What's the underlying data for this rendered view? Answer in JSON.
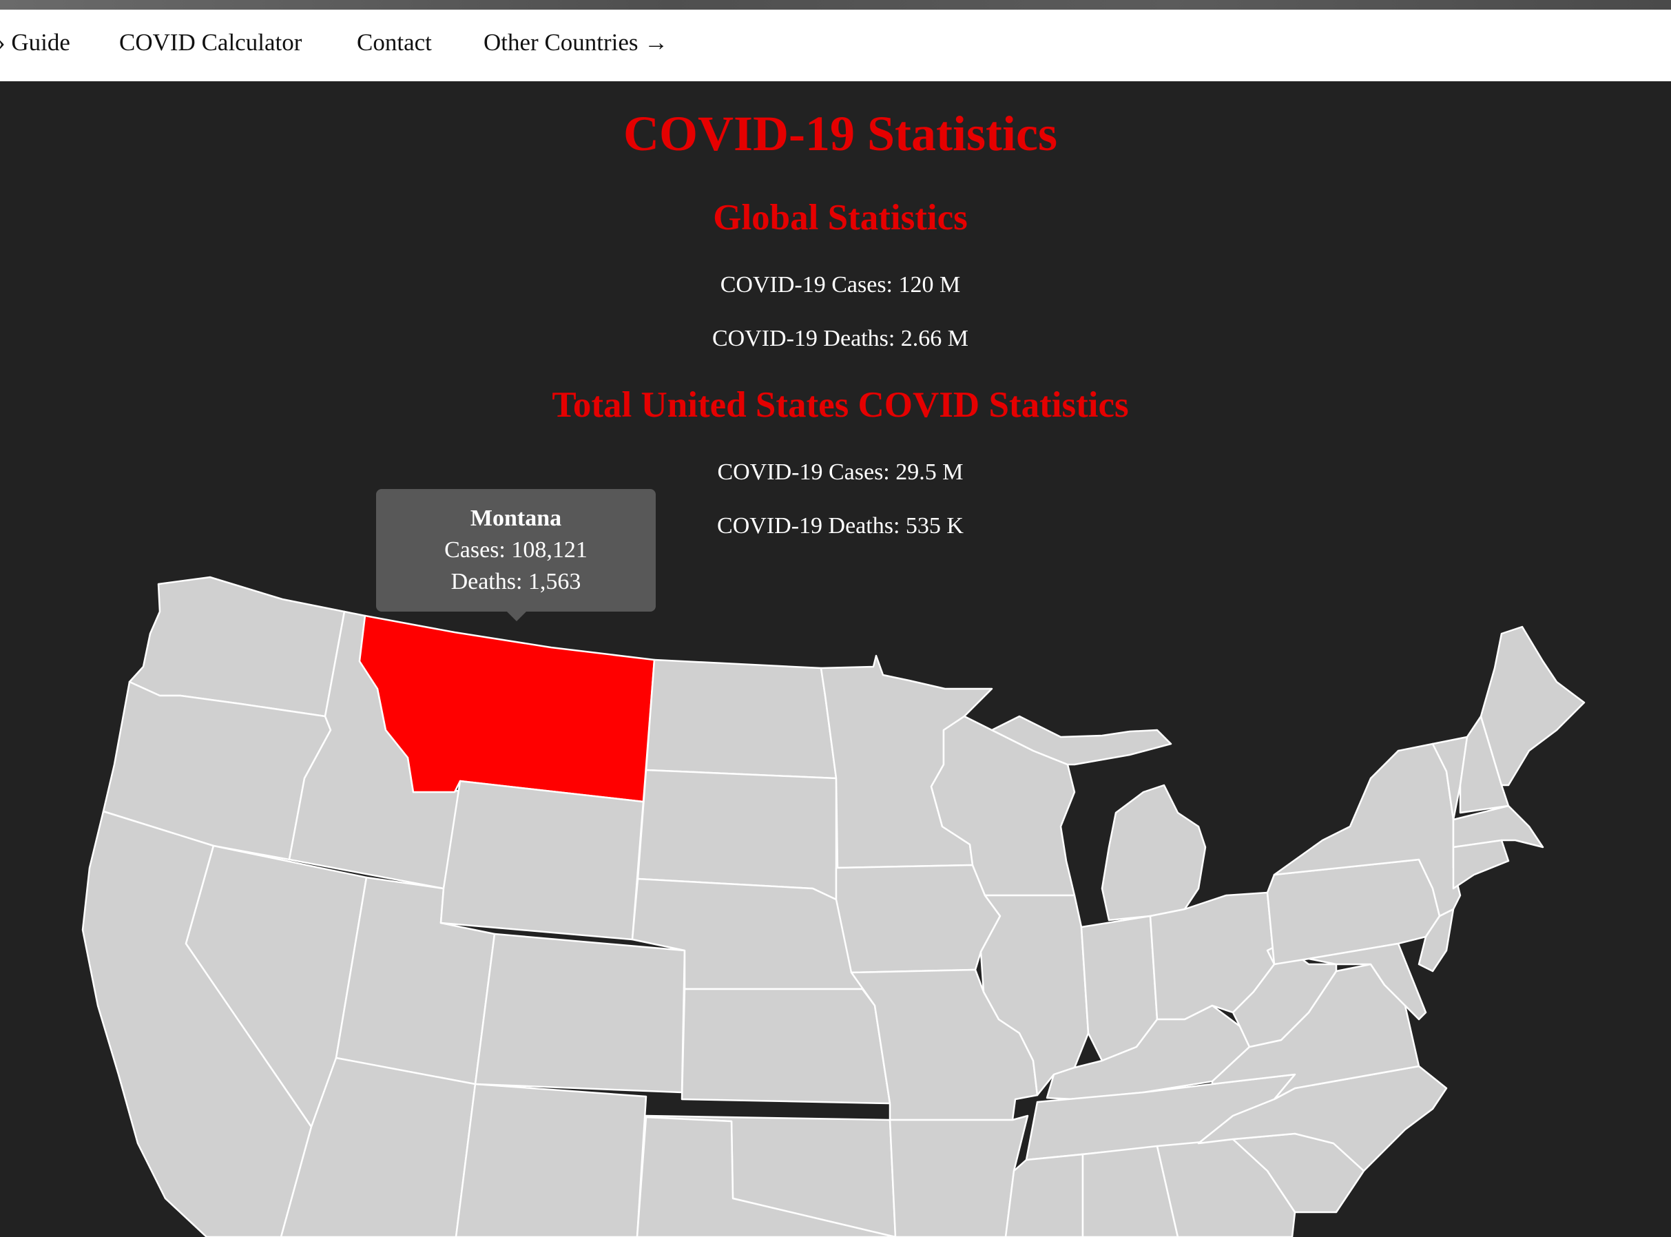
{
  "nav": {
    "items": [
      {
        "label": "› Guide"
      },
      {
        "label": "COVID Calculator"
      },
      {
        "label": "Contact"
      },
      {
        "label": "Other Countries →"
      }
    ]
  },
  "page": {
    "title": "COVID-19 Statistics"
  },
  "global": {
    "heading": "Global Statistics",
    "cases": "COVID-19 Cases: 120 M",
    "deaths": "COVID-19 Deaths: 2.66 M"
  },
  "us": {
    "heading": "Total United States COVID Statistics",
    "cases": "COVID-19 Cases: 29.5 M",
    "deaths": "COVID-19 Deaths: 535 K"
  },
  "map": {
    "highlight_color": "#ff0000",
    "state_color": "#d0d0d0",
    "selected_state": "Montana",
    "tooltip": {
      "title": "Montana",
      "cases": "Cases: 108,121",
      "deaths": "Deaths: 1,563"
    }
  }
}
